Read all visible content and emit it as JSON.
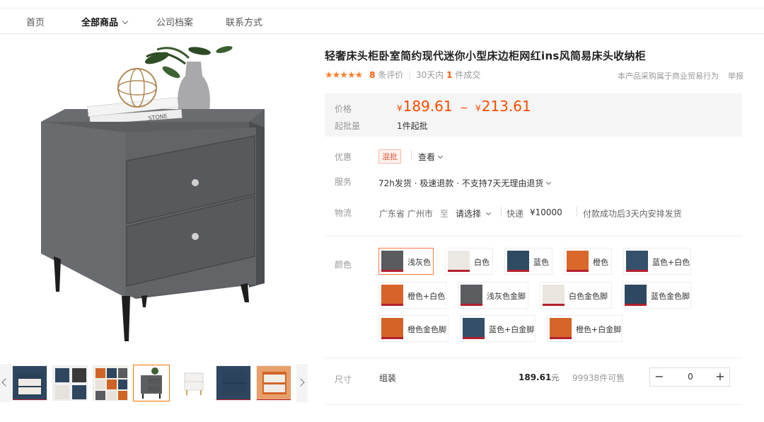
{
  "nav": {
    "home": "首页",
    "all_products": "全部商品",
    "company_profile": "公司档案",
    "contact": "联系方式"
  },
  "product": {
    "title": "轻奢床头柜卧室简约现代迷你小型床边柜网红ins风简易床头收纳柜",
    "rating_stars": "★★★★★",
    "review_count": "8",
    "review_label": "条评价",
    "sales_period": "30天内",
    "sales_count": "1",
    "sales_label": "件成交",
    "commercial_note": "本产品采购属于商业贸易行为",
    "report": "举报"
  },
  "price": {
    "label": "价格",
    "currency": "¥",
    "low": "189.61",
    "tilde": "~",
    "high": "213.61",
    "moq_label": "起批量",
    "moq_value": "1件起批"
  },
  "discount": {
    "label": "优惠",
    "tag": "混批",
    "view": "查看"
  },
  "service": {
    "label": "服务",
    "value": "72h发货 · 极速退款 · 不支持7天无理由退货"
  },
  "logistics": {
    "label": "物流",
    "origin": "广东省 广州市",
    "to": "至",
    "select": "请选择",
    "express": "快递",
    "fee": "¥10000",
    "note": "付款成功后3天内安排发货"
  },
  "color": {
    "label": "颜色",
    "options": [
      {
        "name": "浅灰色",
        "color": "#5a5b5e",
        "selected": true
      },
      {
        "name": "白色",
        "color": "#ece9e4",
        "selected": false
      },
      {
        "name": "蓝色",
        "color": "#2f4a63",
        "selected": false
      },
      {
        "name": "橙色",
        "color": "#d9682a",
        "selected": false
      },
      {
        "name": "蓝色+白色",
        "color": "#34506a",
        "selected": false
      },
      {
        "name": "橙色+白色",
        "color": "#d7632a",
        "selected": false
      },
      {
        "name": "浅灰色金脚",
        "color": "#5c5d60",
        "selected": false
      },
      {
        "name": "白色金色脚",
        "color": "#eae6df",
        "selected": false
      },
      {
        "name": "蓝色金色脚",
        "color": "#2e4861",
        "selected": false
      },
      {
        "name": "橙色金色脚",
        "color": "#d36428",
        "selected": false
      },
      {
        "name": "蓝色+白金脚",
        "color": "#33506b",
        "selected": false
      },
      {
        "name": "橙色+白金脚",
        "color": "#d56629",
        "selected": false
      }
    ]
  },
  "size": {
    "label": "尺寸",
    "option": "组装",
    "price": "189.61",
    "unit": "元",
    "stock": "99938件可售",
    "quantity": "0",
    "minus": "−",
    "plus": "+"
  }
}
